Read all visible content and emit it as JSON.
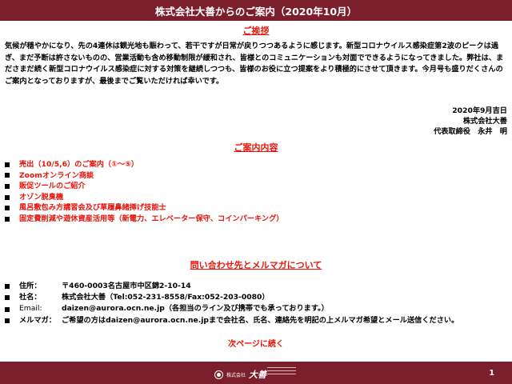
{
  "header": {
    "title": "株式会社大善からのご案内（2020年10月）"
  },
  "greeting": {
    "heading": "ご挨拶",
    "paragraph": "気候が穏やかになり、先の4連休は観光地も賑わって、若干ですが日常が戻りつつあるように感じます。新型コロナウイルス感染症第2波のピークは過ぎ、まだ予断は許さないものの、営業活動も含め移動制限が緩和され、皆様とのコミュニケーションも対面でできるようになってきました。弊社は、まださまだ続く新型コロナウイルス感染症に対する対策を継続しつつも、皆様のお役に立つ提案をより積極的にさせて頂きます。今月号も盛りだくさんのご案内となっておりますが、最後までご覧いただければ幸いです。"
  },
  "signature": {
    "date": "2020年9月吉日",
    "company": "株式会社大善",
    "representative": "代表取締役　永井　明"
  },
  "contents": {
    "heading": "ご案内内容",
    "items": [
      {
        "label": "売出（10/5,6）のご案内（①～⑤）",
        "highlight": true
      },
      {
        "label": "Zoomオンライン商談",
        "highlight": false
      },
      {
        "label": "販促ツールのご紹介",
        "highlight": false
      },
      {
        "label": "オゾン脱臭機",
        "highlight": false
      },
      {
        "label": "風呂敷包み方講習会及び草履鼻緒挿げ技能士",
        "highlight": false
      },
      {
        "label": "固定費削減や遊休資産活用等（新電力、エレベーター保守、コインパーキング）",
        "highlight": false
      }
    ]
  },
  "inquiry": {
    "heading": "問い合わせ先とメルマガについて",
    "rows": [
      {
        "label": "住所：",
        "value": "〒460-0003名古屋市中区錦2-10-14"
      },
      {
        "label": "社名：",
        "value": "株式会社大善（Tel:052-231-8558/Fax:052-203-0080）"
      },
      {
        "label": "Email:",
        "value": "daizen@aurora.ocn.ne.jp（各担当のライン及び携帯でも承っております。）"
      },
      {
        "label": "メルマガ：",
        "value": "ご希望の方はdaizen@aurora.ocn.ne.jpまで会社名、氏名、連絡先を明記の上メルマガ希望とメール送信ください。"
      }
    ]
  },
  "next_page": "次ページに続く",
  "footer": {
    "company_small": "株式会社",
    "brand": "大善",
    "page_number": "1"
  },
  "colors": {
    "banner": "#7a1f2b",
    "accent_red": "#e8150a"
  }
}
